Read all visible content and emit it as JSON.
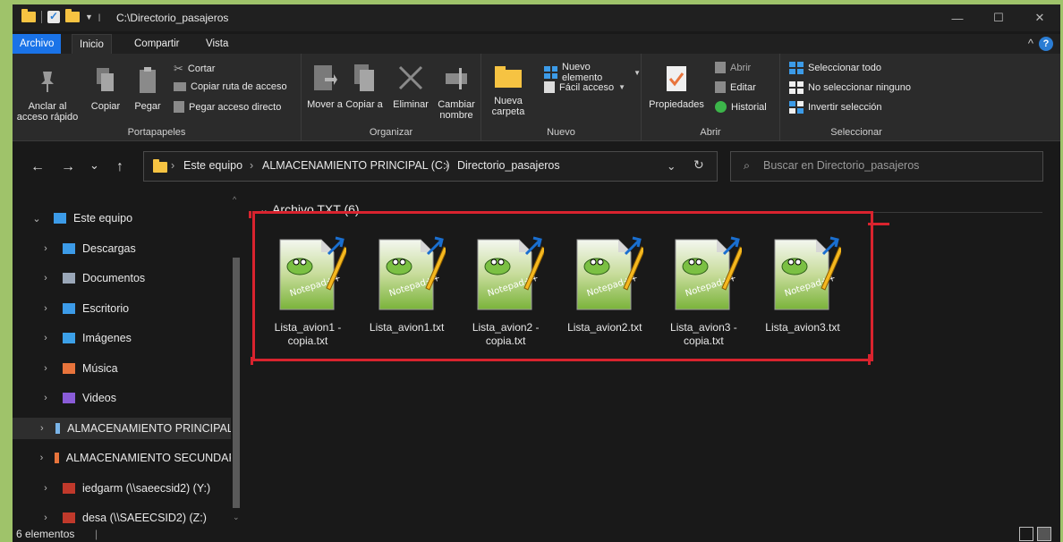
{
  "window": {
    "path": "C:\\Directorio_pasajeros",
    "qa_sep": "|",
    "qa_dropdown": "▼",
    "controls": {
      "minimize": "—",
      "maximize": "☐",
      "close": "✕"
    }
  },
  "tabs": [
    {
      "label": "Archivo"
    },
    {
      "label": "Inicio"
    },
    {
      "label": "Compartir"
    },
    {
      "label": "Vista"
    }
  ],
  "ribbon": {
    "collapse_icon": "^",
    "help_label": "?",
    "portapapeles": {
      "label": "Portapapeles",
      "pin": "Anclar al acceso rápido",
      "copy": "Copiar",
      "paste": "Pegar",
      "cut": "Cortar",
      "copy_path": "Copiar ruta de acceso",
      "paste_shortcut": "Pegar acceso directo"
    },
    "organizar": {
      "label": "Organizar",
      "move": "Mover a",
      "copy_to": "Copiar a",
      "delete": "Eliminar",
      "rename": "Cambiar nombre"
    },
    "nuevo": {
      "label": "Nuevo",
      "new_folder": "Nueva carpeta",
      "new_item": "Nuevo elemento",
      "easy_access": "Fácil acceso"
    },
    "abrir": {
      "label": "Abrir",
      "properties": "Propiedades",
      "open": "Abrir",
      "edit": "Editar",
      "history": "Historial"
    },
    "seleccionar": {
      "label": "Seleccionar",
      "select_all": "Seleccionar todo",
      "select_none": "No seleccionar ninguno",
      "invert": "Invertir selección"
    }
  },
  "address": {
    "crumbs": [
      "Este equipo",
      "ALMACENAMIENTO PRINCIPAL (C:)",
      "Directorio_pasajeros"
    ],
    "separator": "›",
    "search_placeholder": "Buscar en Directorio_pasajeros",
    "nav": {
      "back": "←",
      "forward": "→",
      "recent": "⌄",
      "up": "↑",
      "dropdown": "⌄",
      "refresh": "↻",
      "search_glyph": "⌕"
    }
  },
  "sidebar": {
    "items": [
      {
        "label": "Este equipo",
        "color": "#3c9be8",
        "chevron": "⌄"
      },
      {
        "label": "Descargas",
        "color": "#3c9be8",
        "chevron": "›"
      },
      {
        "label": "Documentos",
        "color": "#9aa7b8",
        "chevron": "›"
      },
      {
        "label": "Escritorio",
        "color": "#3c9be8",
        "chevron": "›"
      },
      {
        "label": "Imágenes",
        "color": "#3ca0e8",
        "chevron": "›"
      },
      {
        "label": "Música",
        "color": "#e8743c",
        "chevron": "›"
      },
      {
        "label": "Videos",
        "color": "#8a5cd8",
        "chevron": "›"
      },
      {
        "label": "ALMACENAMIENTO PRINCIPAL (",
        "color": "#7ab4e8",
        "chevron": "›"
      },
      {
        "label": "ALMACENAMIENTO SECUNDARI",
        "color": "#e8743c",
        "chevron": "›"
      },
      {
        "label": "iedgarm (\\\\saeecsid2) (Y:)",
        "color": "#c0392b",
        "chevron": "›"
      },
      {
        "label": "desa (\\\\SAEECSID2) (Z:)",
        "color": "#c0392b",
        "chevron": "›"
      }
    ],
    "scroll_up": "^",
    "scroll_down": "⌄"
  },
  "content": {
    "group_title": "Archivo TXT (6)",
    "group_chevron": "⌄",
    "files": [
      {
        "name": "Lista_avion1 - copia.txt"
      },
      {
        "name": "Lista_avion1.txt"
      },
      {
        "name": "Lista_avion2 - copia.txt"
      },
      {
        "name": "Lista_avion2.txt"
      },
      {
        "name": "Lista_avion3 - copia.txt"
      },
      {
        "name": "Lista_avion3.txt"
      }
    ],
    "icon_text": "Notepad++",
    "highlight_color": "#d9232e"
  },
  "status": {
    "count": "6 elementos",
    "sep": "|"
  }
}
